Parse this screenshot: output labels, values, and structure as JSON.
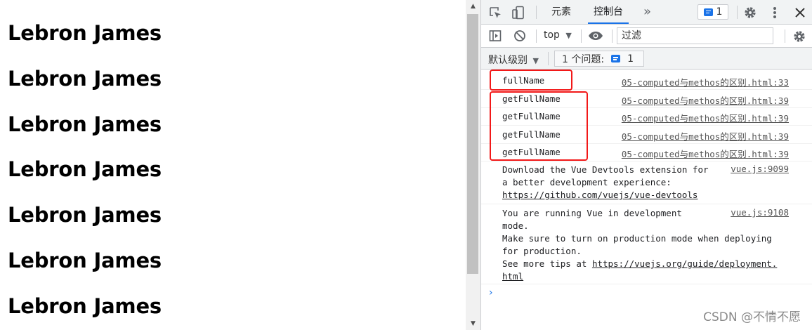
{
  "page": {
    "headlines": [
      "Lebron James",
      "Lebron James",
      "Lebron James",
      "Lebron James",
      "Lebron James",
      "Lebron James",
      "Lebron James"
    ]
  },
  "devtools": {
    "tabs": [
      "元素",
      "控制台"
    ],
    "more_tabs": "»",
    "issues_badge": "1",
    "toolbar": {
      "context": "top",
      "context_arrow": "▼",
      "filter_placeholder": "过滤"
    },
    "levelbar": {
      "level": "默认级别",
      "level_arrow": "▼",
      "issues_label": "1 个问题:",
      "issues_count": "1"
    },
    "logs": [
      {
        "message": "fullName",
        "source": "05-computed与methos的区别.html:33"
      },
      {
        "message": "getFullName",
        "source": "05-computed与methos的区别.html:39"
      },
      {
        "message": "getFullName",
        "source": "05-computed与methos的区别.html:39"
      },
      {
        "message": "getFullName",
        "source": "05-computed与methos的区别.html:39"
      },
      {
        "message": "getFullName",
        "source": "05-computed与methos的区别.html:39"
      }
    ],
    "devtools_msg": {
      "line1": "Download the Vue Devtools extension for",
      "line2": "a better development experience:",
      "link": "https://github.com/vuejs/vue-devtools",
      "source": "vue.js:9099"
    },
    "prod_msg": {
      "line1": "You are running Vue in development",
      "line2": "mode.",
      "line3": "Make sure to turn on production mode when deploying",
      "line4": "for production.",
      "line5_prefix": "See more tips at ",
      "link_part1": "https://vuejs.org/guide/deployment.",
      "link_part2": "html",
      "source": "vue.js:9108"
    },
    "prompt": "›"
  },
  "watermark": "CSDN @不情不愿",
  "colors": {
    "highlight": "#f21818",
    "accent": "#1a73e8"
  }
}
